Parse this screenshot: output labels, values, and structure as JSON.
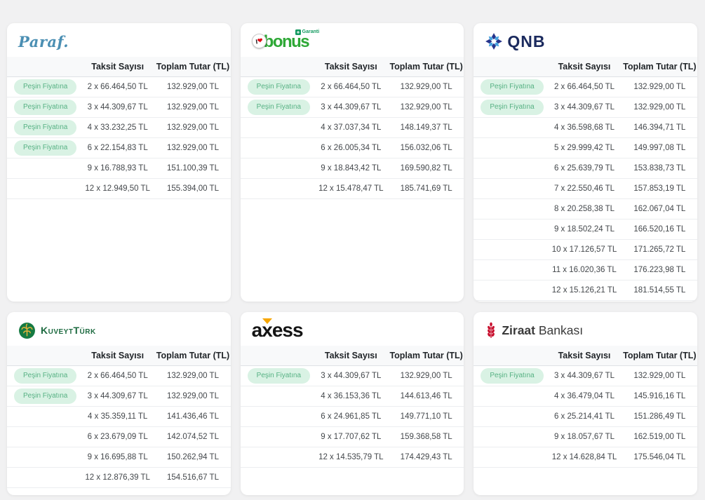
{
  "labels": {
    "col_installments": "Taksit Sayısı",
    "col_total": "Toplam Tutar (TL)",
    "badge_label": "Peşin Fiyatına"
  },
  "colors": {
    "page_bg": "#f1f1f2",
    "badge_bg": "#d9f2e4",
    "badge_text": "#56b183",
    "paraf_blue": "#4b8fb3",
    "bonus_green": "#2ea836",
    "bonus_heart_red": "#e30613",
    "garanti_green": "#169b62",
    "qnb_navy": "#1b2a5e",
    "qnb_light_blue": "#4aa3df",
    "kuveyt_green": "#1e6b41",
    "axess_orange": "#f7a600",
    "ziraat_red": "#c8102e"
  },
  "cards": [
    {
      "bank": "Paraf",
      "logo": {
        "text": "Paraf."
      },
      "rows": [
        {
          "badge": true,
          "installment": "2 x 66.464,50 TL",
          "total": "132.929,00 TL"
        },
        {
          "badge": true,
          "installment": "3 x 44.309,67 TL",
          "total": "132.929,00 TL"
        },
        {
          "badge": true,
          "installment": "4 x 33.232,25 TL",
          "total": "132.929,00 TL"
        },
        {
          "badge": true,
          "installment": "6 x 22.154,83 TL",
          "total": "132.929,00 TL"
        },
        {
          "badge": false,
          "installment": "9 x 16.788,93 TL",
          "total": "151.100,39 TL"
        },
        {
          "badge": false,
          "installment": "12 x 12.949,50 TL",
          "total": "155.394,00 TL"
        }
      ]
    },
    {
      "bank": "Bonus",
      "logo": {
        "circle_i": "I",
        "heart": "❤",
        "text": "bonus",
        "sub_brand": "Garanti"
      },
      "rows": [
        {
          "badge": true,
          "installment": "2 x 66.464,50 TL",
          "total": "132.929,00 TL"
        },
        {
          "badge": true,
          "installment": "3 x 44.309,67 TL",
          "total": "132.929,00 TL"
        },
        {
          "badge": false,
          "installment": "4 x 37.037,34 TL",
          "total": "148.149,37 TL"
        },
        {
          "badge": false,
          "installment": "6 x 26.005,34 TL",
          "total": "156.032,06 TL"
        },
        {
          "badge": false,
          "installment": "9 x 18.843,42 TL",
          "total": "169.590,82 TL"
        },
        {
          "badge": false,
          "installment": "12 x 15.478,47 TL",
          "total": "185.741,69 TL"
        }
      ]
    },
    {
      "bank": "QNB",
      "logo": {
        "text": "QNB"
      },
      "rows": [
        {
          "badge": true,
          "installment": "2 x 66.464,50 TL",
          "total": "132.929,00 TL"
        },
        {
          "badge": true,
          "installment": "3 x 44.309,67 TL",
          "total": "132.929,00 TL"
        },
        {
          "badge": false,
          "installment": "4 x 36.598,68 TL",
          "total": "146.394,71 TL"
        },
        {
          "badge": false,
          "installment": "5 x 29.999,42 TL",
          "total": "149.997,08 TL"
        },
        {
          "badge": false,
          "installment": "6 x 25.639,79 TL",
          "total": "153.838,73 TL"
        },
        {
          "badge": false,
          "installment": "7 x 22.550,46 TL",
          "total": "157.853,19 TL"
        },
        {
          "badge": false,
          "installment": "8 x 20.258,38 TL",
          "total": "162.067,04 TL"
        },
        {
          "badge": false,
          "installment": "9 x 18.502,24 TL",
          "total": "166.520,16 TL"
        },
        {
          "badge": false,
          "installment": "10 x 17.126,57 TL",
          "total": "171.265,72 TL"
        },
        {
          "badge": false,
          "installment": "11 x 16.020,36 TL",
          "total": "176.223,98 TL"
        },
        {
          "badge": false,
          "installment": "12 x 15.126,21 TL",
          "total": "181.514,55 TL"
        }
      ]
    },
    {
      "bank": "KuveytTürk",
      "logo": {
        "text": "KuveytTürk"
      },
      "rows": [
        {
          "badge": true,
          "installment": "2 x 66.464,50 TL",
          "total": "132.929,00 TL"
        },
        {
          "badge": true,
          "installment": "3 x 44.309,67 TL",
          "total": "132.929,00 TL"
        },
        {
          "badge": false,
          "installment": "4 x 35.359,11 TL",
          "total": "141.436,46 TL"
        },
        {
          "badge": false,
          "installment": "6 x 23.679,09 TL",
          "total": "142.074,52 TL"
        },
        {
          "badge": false,
          "installment": "9 x 16.695,88 TL",
          "total": "150.262,94 TL"
        },
        {
          "badge": false,
          "installment": "12 x 12.876,39 TL",
          "total": "154.516,67 TL"
        }
      ]
    },
    {
      "bank": "Axess",
      "logo": {
        "part_a": "a",
        "part_x": "x",
        "part_ess": "ess"
      },
      "rows": [
        {
          "badge": true,
          "installment": "3 x 44.309,67 TL",
          "total": "132.929,00 TL"
        },
        {
          "badge": false,
          "installment": "4 x 36.153,36 TL",
          "total": "144.613,46 TL"
        },
        {
          "badge": false,
          "installment": "6 x 24.961,85 TL",
          "total": "149.771,10 TL"
        },
        {
          "badge": false,
          "installment": "9 x 17.707,62 TL",
          "total": "159.368,58 TL"
        },
        {
          "badge": false,
          "installment": "12 x 14.535,79 TL",
          "total": "174.429,43 TL"
        }
      ]
    },
    {
      "bank": "Ziraat Bankası",
      "logo": {
        "bold": "Ziraat",
        "rest": "Bankası"
      },
      "rows": [
        {
          "badge": true,
          "installment": "3 x 44.309,67 TL",
          "total": "132.929,00 TL"
        },
        {
          "badge": false,
          "installment": "4 x 36.479,04 TL",
          "total": "145.916,16 TL"
        },
        {
          "badge": false,
          "installment": "6 x 25.214,41 TL",
          "total": "151.286,49 TL"
        },
        {
          "badge": false,
          "installment": "9 x 18.057,67 TL",
          "total": "162.519,00 TL"
        },
        {
          "badge": false,
          "installment": "12 x 14.628,84 TL",
          "total": "175.546,04 TL"
        }
      ]
    }
  ]
}
